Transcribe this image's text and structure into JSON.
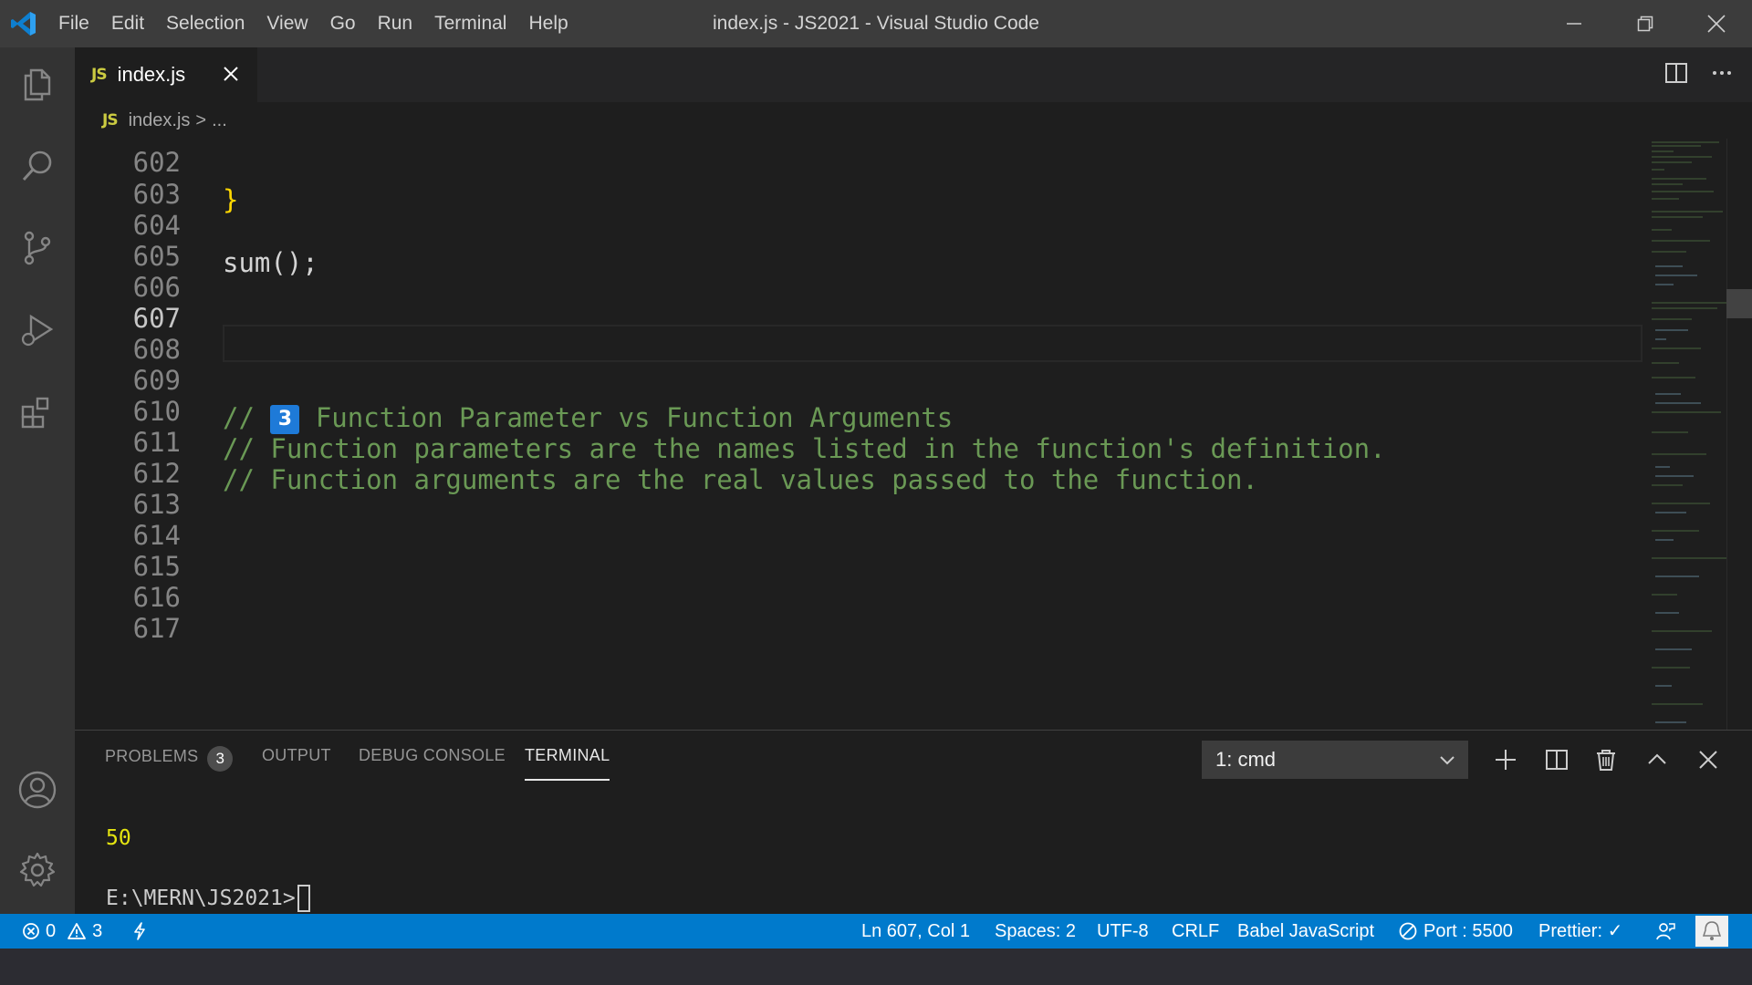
{
  "window": {
    "title": "index.js - JS2021 - Visual Studio Code"
  },
  "menu": [
    "File",
    "Edit",
    "Selection",
    "View",
    "Go",
    "Run",
    "Terminal",
    "Help"
  ],
  "tab": {
    "icon_label": "JS",
    "label": "index.js"
  },
  "breadcrumb": {
    "icon_label": "JS",
    "file": "index.js",
    "separator": ">",
    "more": "..."
  },
  "editor": {
    "lines": [
      {
        "number": "602",
        "code": "}"
      },
      {
        "number": "603",
        "code": ""
      },
      {
        "number": "604",
        "code": "sum();"
      },
      {
        "number": "605",
        "code": ""
      },
      {
        "number": "606",
        "code": ""
      },
      {
        "number": "607",
        "code": ""
      },
      {
        "number": "608",
        "code": ""
      },
      {
        "number": "609",
        "code_prefix": "// ",
        "emoji": "3",
        "code_suffix": " Function Parameter vs Function Arguments"
      },
      {
        "number": "610",
        "code": "// Function parameters are the names listed in the function's definition."
      },
      {
        "number": "611",
        "code": "// Function arguments are the real values passed to the function."
      },
      {
        "number": "612",
        "code": ""
      },
      {
        "number": "613",
        "code": ""
      },
      {
        "number": "614",
        "code": ""
      },
      {
        "number": "615",
        "code": ""
      },
      {
        "number": "616",
        "code": ""
      },
      {
        "number": "617",
        "code": ""
      }
    ],
    "active_line": "607"
  },
  "panel": {
    "tabs": {
      "problems": "PROBLEMS",
      "problems_count": "3",
      "output": "OUTPUT",
      "debug_console": "DEBUG CONSOLE",
      "terminal": "TERMINAL"
    },
    "terminal_selector": "1: cmd",
    "terminal": {
      "output": "50",
      "prompt": "E:\\MERN\\JS2021>"
    }
  },
  "statusbar": {
    "errors": "0",
    "warnings": "3",
    "position": "Ln 607, Col 1",
    "spaces": "Spaces: 2",
    "encoding": "UTF-8",
    "eol": "CRLF",
    "language": "Babel JavaScript",
    "port": "Port : 5500",
    "prettier": "Prettier: ✓"
  },
  "colors": {
    "accent": "#007acc",
    "comment": "#6a9955",
    "js_icon": "#cbcb41",
    "terminal_output": "#e5e510"
  }
}
